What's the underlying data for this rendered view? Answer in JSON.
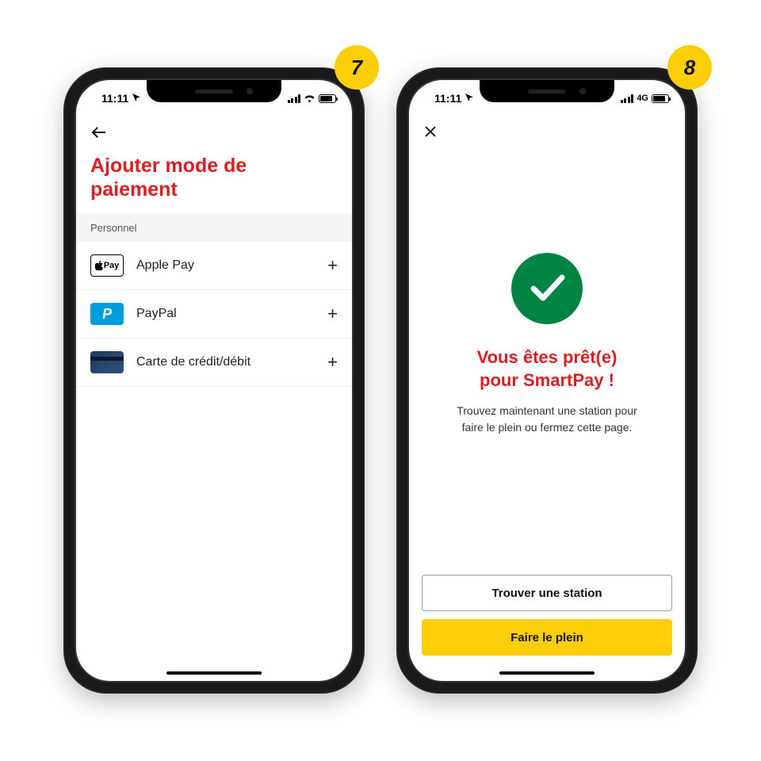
{
  "step7": {
    "badge": "7",
    "status_time": "11:11",
    "title_line1": "Ajouter mode de",
    "title_line2": "paiement",
    "section_label": "Personnel",
    "methods": [
      {
        "label": "Apple Pay"
      },
      {
        "label": "PayPal"
      },
      {
        "label": "Carte de crédit/débit"
      }
    ]
  },
  "step8": {
    "badge": "8",
    "status_time": "11:11",
    "network": "4G",
    "heading_line1": "Vous êtes prêt(e)",
    "heading_line2": "pour SmartPay !",
    "sub_line1": "Trouvez maintenant une station pour",
    "sub_line2": "faire le plein ou fermez cette page.",
    "btn_find": "Trouver une station",
    "btn_fill": "Faire le plein"
  }
}
